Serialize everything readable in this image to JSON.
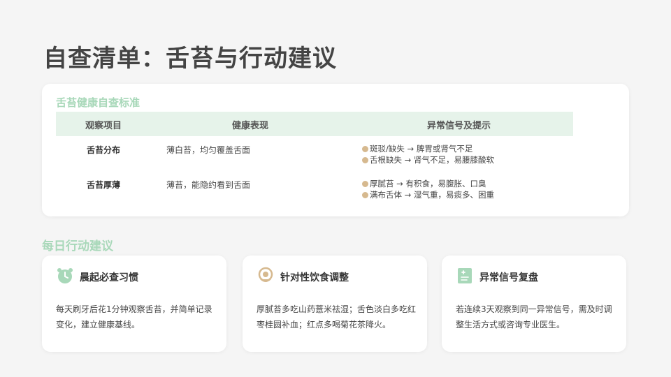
{
  "page_title": "自查清单：舌苔与行动建议",
  "standards": {
    "section_title": "舌苔健康自查标准",
    "headers": [
      "观察项目",
      "健康表现",
      "异常信号及提示"
    ],
    "rows": [
      {
        "item": "舌苔分布",
        "healthy": "薄白苔，均匀覆盖舌面",
        "signals": [
          "斑驳/缺失 → 脾胃或肾气不足",
          "舌根缺失 → 肾气不足，易腰膝酸软"
        ]
      },
      {
        "item": "舌苔厚薄",
        "healthy": "薄苔，能隐约看到舌面",
        "signals": [
          "厚腻苔 → 有积食，易腹胀、口臭",
          "满布舌体 → 湿气重，易痰多、困重"
        ]
      }
    ]
  },
  "actions": {
    "section_title": "每日行动建议",
    "cards": [
      {
        "icon": "alarm-clock-icon",
        "title": "晨起必查习惯",
        "body": "每天刷牙后花1分钟观察舌苔，并简单记录变化，建立健康基线。"
      },
      {
        "icon": "food-bowl-icon",
        "title": "针对性饮食调整",
        "body": "厚腻苔多吃山药薏米祛湿；舌色淡白多吃红枣桂圆补血；红点多喝菊花茶降火。"
      },
      {
        "icon": "medical-record-icon",
        "title": "异常信号复盘",
        "body": "若连续3天观察到同一异常信号，需及时调整生活方式或咨询专业医生。"
      }
    ]
  },
  "colors": {
    "accent_green": "#a8d8b9",
    "header_bg": "#e6f3ea",
    "bullet": "#d6b98f",
    "background": "#f5f5f5"
  }
}
